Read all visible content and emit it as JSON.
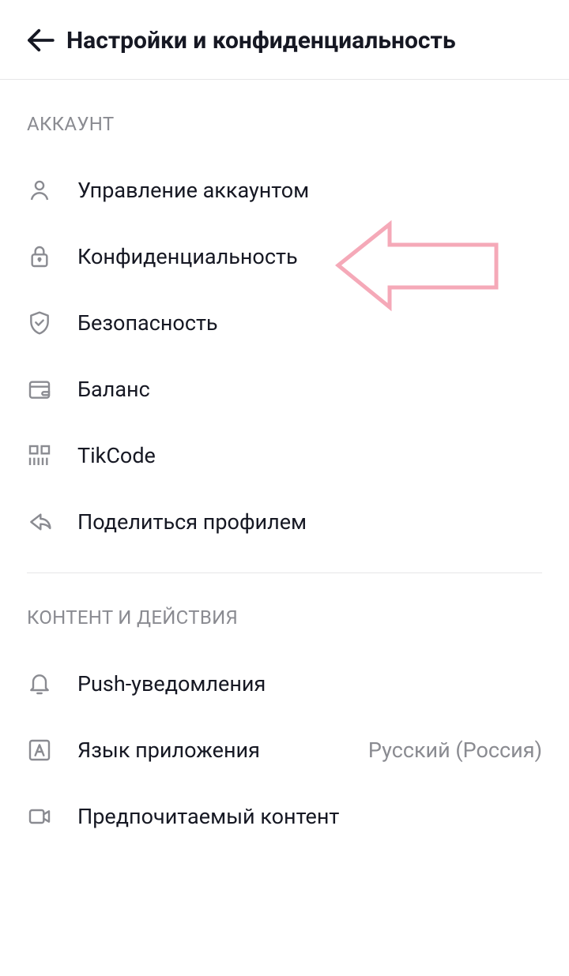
{
  "header": {
    "title": "Настройки и конфиденциальность"
  },
  "sections": {
    "account": {
      "title": "АККАУНТ",
      "items": [
        {
          "label": "Управление аккаунтом"
        },
        {
          "label": "Конфиденциальность"
        },
        {
          "label": "Безопасность"
        },
        {
          "label": "Баланс"
        },
        {
          "label": "TikCode"
        },
        {
          "label": "Поделиться профилем"
        }
      ]
    },
    "content": {
      "title": "КОНТЕНТ И ДЕЙСТВИЯ",
      "items": [
        {
          "label": "Push-уведомления",
          "value": ""
        },
        {
          "label": "Язык приложения",
          "value": "Русский (Россия)"
        },
        {
          "label": "Предпочитаемый контент",
          "value": ""
        }
      ]
    }
  }
}
